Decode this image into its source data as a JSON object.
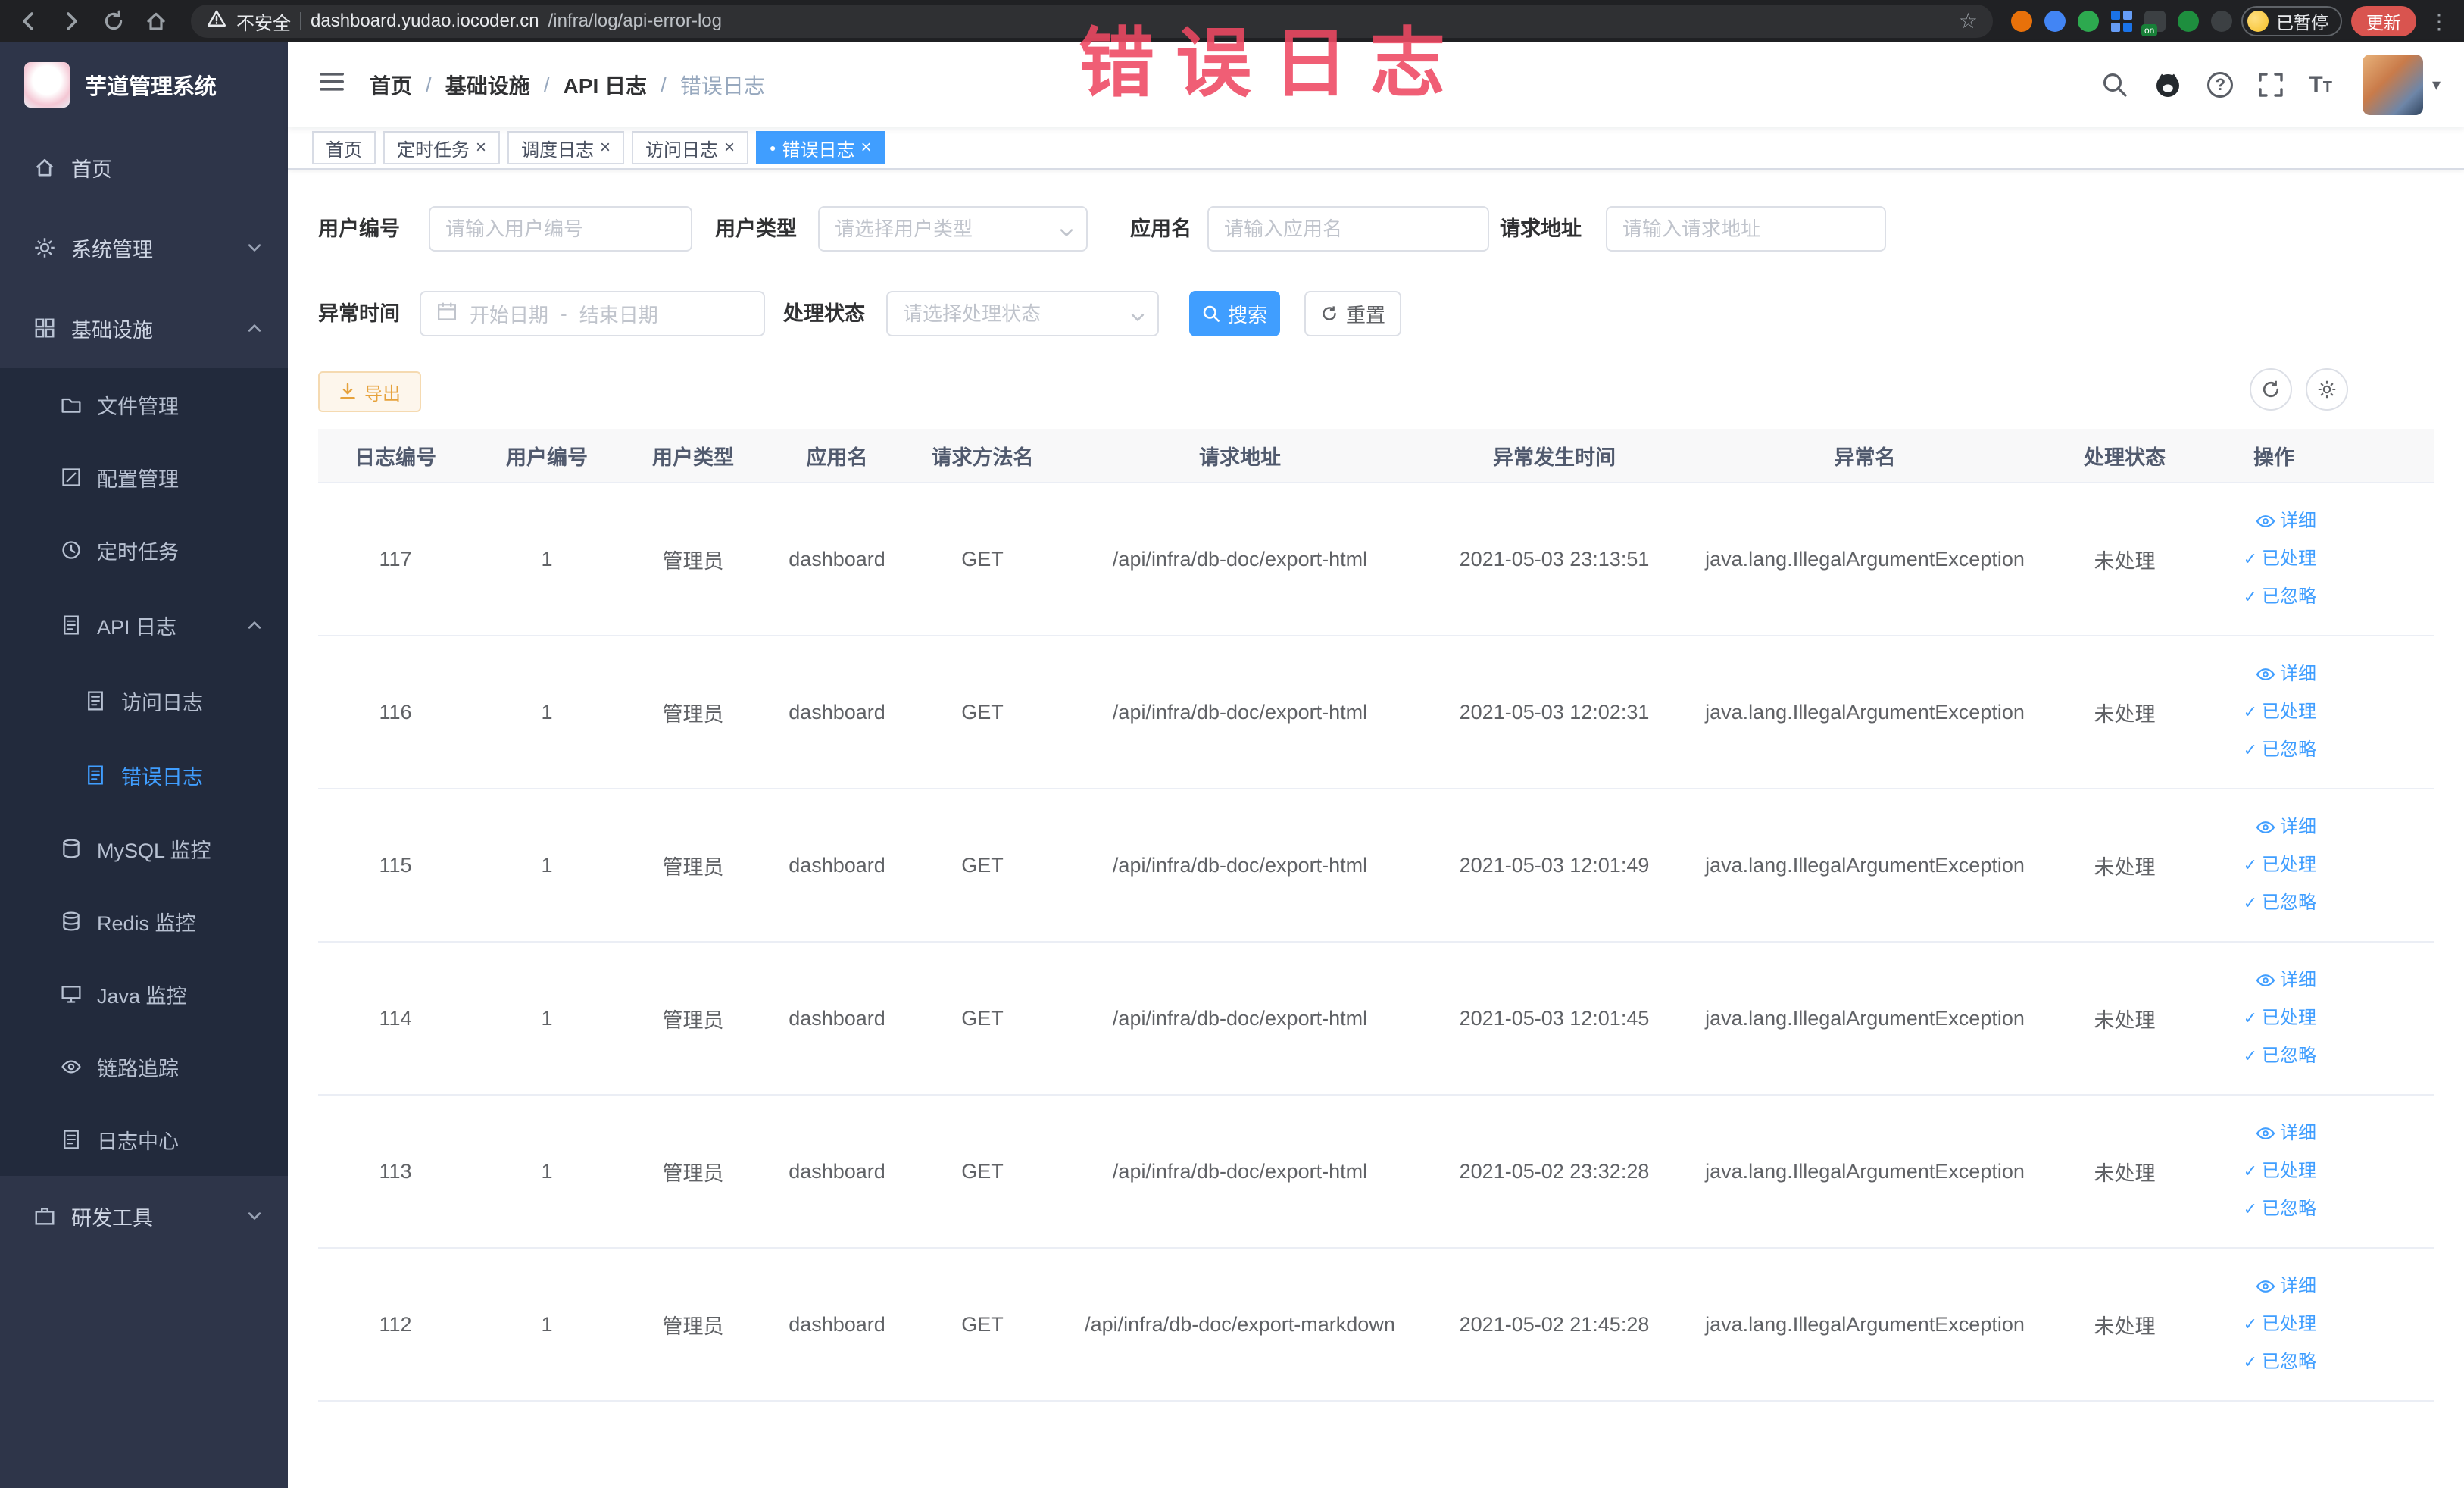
{
  "browser": {
    "security_label": "不安全",
    "url_domain": "dashboard.yudao.iocoder.cn",
    "url_path": "/infra/log/api-error-log",
    "paused_badge": "已暂停",
    "update_button": "更新"
  },
  "annotation": {
    "text": "错误日志"
  },
  "icons": {
    "tab_close": "×",
    "tab_active_dot": "●",
    "check": "✓",
    "star": "☆",
    "kebab": "⋮",
    "caret_down": "▾",
    "question": "?",
    "font_size": "T"
  },
  "sidebar": {
    "logo_title": "芋道管理系统",
    "items": [
      {
        "label": "首页"
      },
      {
        "label": "系统管理"
      },
      {
        "label": "基础设施"
      },
      {
        "label": "文件管理"
      },
      {
        "label": "配置管理"
      },
      {
        "label": "定时任务"
      },
      {
        "label": "API 日志"
      },
      {
        "label": "访问日志"
      },
      {
        "label": "错误日志",
        "active": true
      },
      {
        "label": "MySQL 监控"
      },
      {
        "label": "Redis 监控"
      },
      {
        "label": "Java 监控"
      },
      {
        "label": "链路追踪"
      },
      {
        "label": "日志中心"
      },
      {
        "label": "研发工具"
      }
    ]
  },
  "header": {
    "breadcrumb": [
      "首页",
      "基础设施",
      "API 日志",
      "错误日志"
    ],
    "separator": "/"
  },
  "tabs": [
    {
      "label": "首页",
      "closable": false,
      "active": false
    },
    {
      "label": "定时任务",
      "closable": true,
      "active": false
    },
    {
      "label": "调度日志",
      "closable": true,
      "active": false
    },
    {
      "label": "访问日志",
      "closable": true,
      "active": false
    },
    {
      "label": "错误日志",
      "closable": true,
      "active": true
    }
  ],
  "filters": {
    "user_id": {
      "label": "用户编号",
      "placeholder": "请输入用户编号"
    },
    "user_type": {
      "label": "用户类型",
      "placeholder": "请选择用户类型"
    },
    "app_name": {
      "label": "应用名",
      "placeholder": "请输入应用名"
    },
    "request_url": {
      "label": "请求地址",
      "placeholder": "请输入请求地址"
    },
    "exception_time": {
      "label": "异常时间",
      "start_placeholder": "开始日期",
      "separator": "-",
      "end_placeholder": "结束日期"
    },
    "process_status": {
      "label": "处理状态",
      "placeholder": "请选择处理状态"
    },
    "search_button": "搜索",
    "reset_button": "重置"
  },
  "toolbar": {
    "export_button": "导出"
  },
  "table": {
    "columns": [
      "日志编号",
      "用户编号",
      "用户类型",
      "应用名",
      "请求方法名",
      "请求地址",
      "异常发生时间",
      "异常名",
      "处理状态",
      "操作"
    ],
    "actions": [
      "详细",
      "已处理",
      "已忽略"
    ],
    "rows": [
      {
        "log_id": "117",
        "user_id": "1",
        "user_type": "管理员",
        "app_name": "dashboard",
        "method": "GET",
        "url": "/api/infra/db-doc/export-html",
        "time": "2021-05-03 23:13:51",
        "exception": "java.lang.IllegalArgumentException",
        "status": "未处理"
      },
      {
        "log_id": "116",
        "user_id": "1",
        "user_type": "管理员",
        "app_name": "dashboard",
        "method": "GET",
        "url": "/api/infra/db-doc/export-html",
        "time": "2021-05-03 12:02:31",
        "exception": "java.lang.IllegalArgumentException",
        "status": "未处理"
      },
      {
        "log_id": "115",
        "user_id": "1",
        "user_type": "管理员",
        "app_name": "dashboard",
        "method": "GET",
        "url": "/api/infra/db-doc/export-html",
        "time": "2021-05-03 12:01:49",
        "exception": "java.lang.IllegalArgumentException",
        "status": "未处理"
      },
      {
        "log_id": "114",
        "user_id": "1",
        "user_type": "管理员",
        "app_name": "dashboard",
        "method": "GET",
        "url": "/api/infra/db-doc/export-html",
        "time": "2021-05-03 12:01:45",
        "exception": "java.lang.IllegalArgumentException",
        "status": "未处理"
      },
      {
        "log_id": "113",
        "user_id": "1",
        "user_type": "管理员",
        "app_name": "dashboard",
        "method": "GET",
        "url": "/api/infra/db-doc/export-html",
        "time": "2021-05-02 23:32:28",
        "exception": "java.lang.IllegalArgumentException",
        "status": "未处理"
      },
      {
        "log_id": "112",
        "user_id": "1",
        "user_type": "管理员",
        "app_name": "dashboard",
        "method": "GET",
        "url": "/api/infra/db-doc/export-markdown",
        "time": "2021-05-02 21:45:28",
        "exception": "java.lang.IllegalArgumentException",
        "status": "未处理"
      }
    ]
  },
  "colors": {
    "accent": "#409eff",
    "sidebar_bg": "#2e3549",
    "submenu_bg": "#222a3c",
    "warning": "#e6a23c",
    "annotation": "#ee4862",
    "update_button_bg": "#d9544f"
  }
}
